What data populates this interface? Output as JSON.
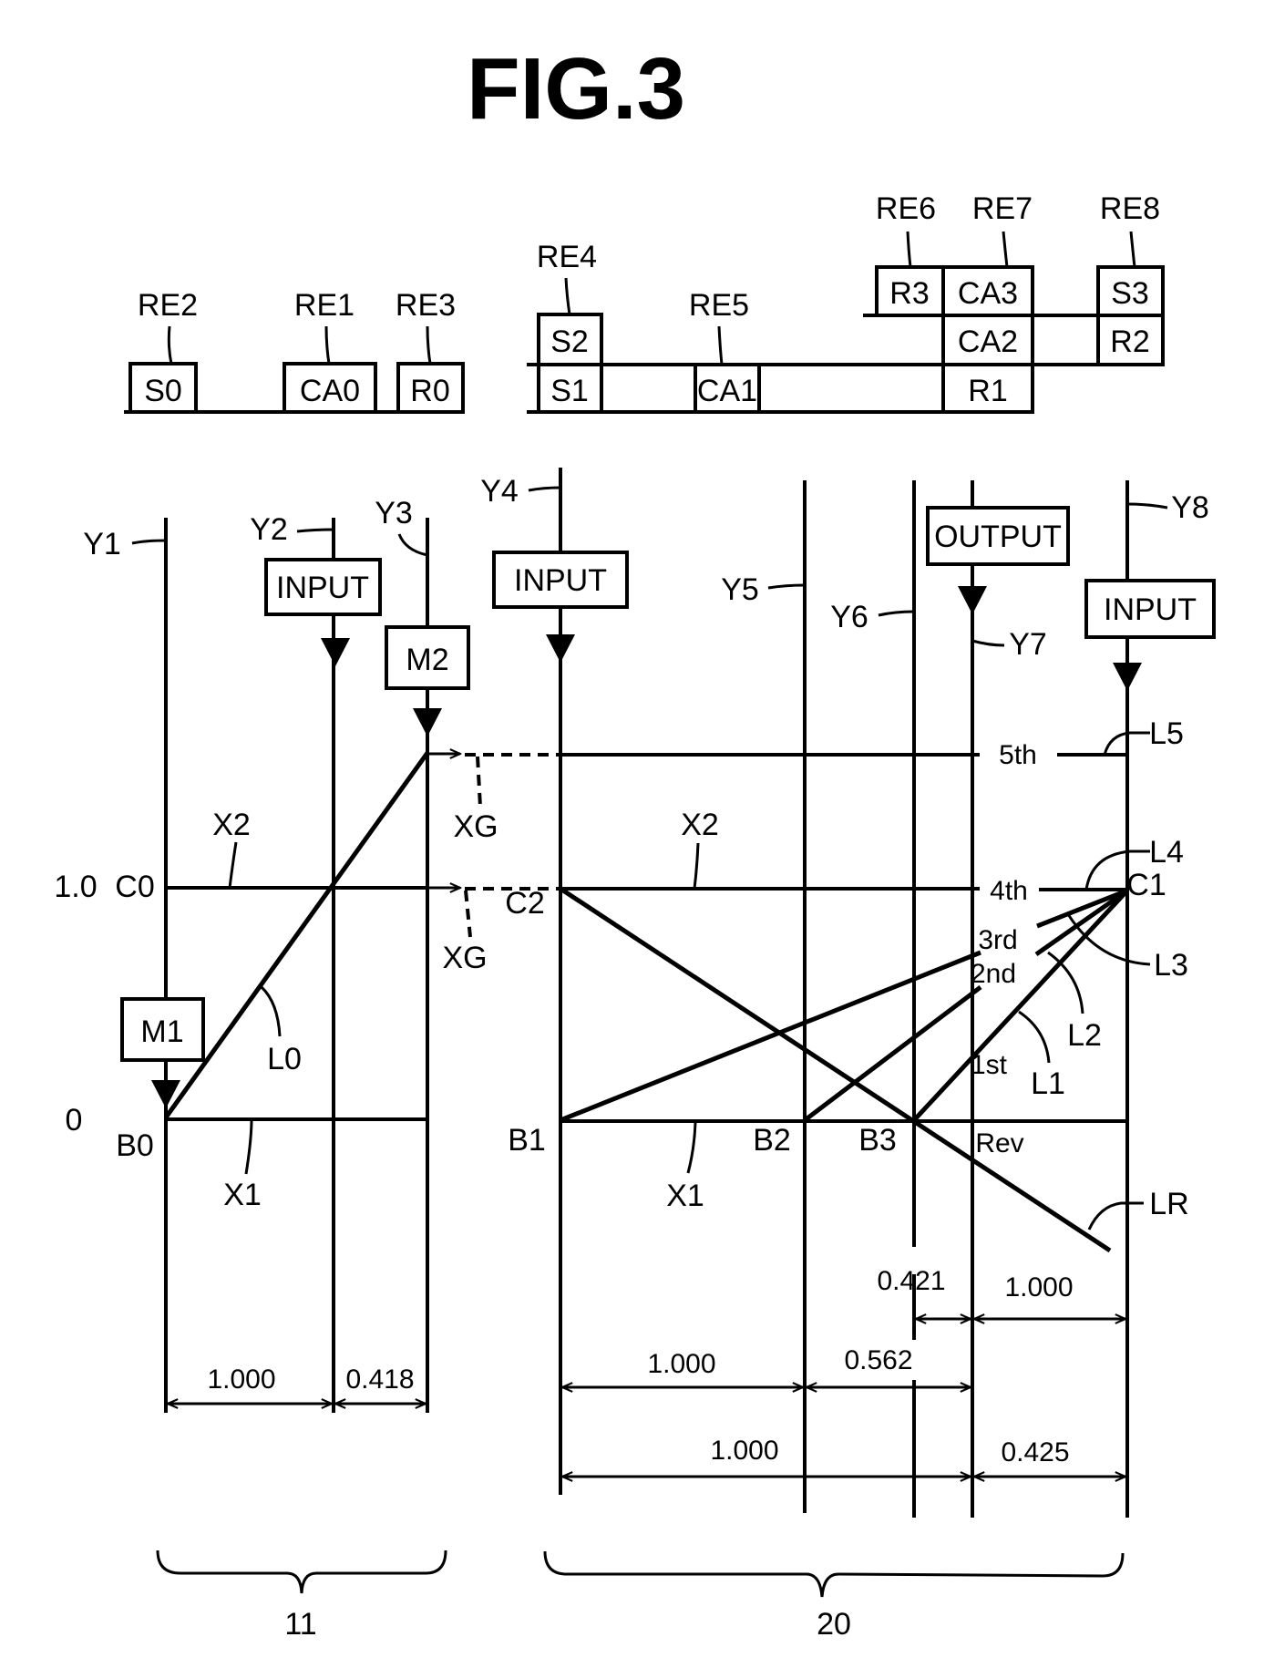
{
  "figure": {
    "title": "FIG.3"
  },
  "elements_top_left": {
    "labels": [
      "RE2",
      "RE1",
      "RE3"
    ],
    "boxes": [
      "S0",
      "CA0",
      "R0"
    ]
  },
  "elements_top_right": {
    "labels": [
      "RE4",
      "RE5",
      "RE6",
      "RE7",
      "RE8"
    ],
    "boxes": {
      "s2": "S2",
      "s1": "S1",
      "ca1": "CA1",
      "r3": "R3",
      "ca3": "CA3",
      "ca2": "CA2",
      "r1": "R1",
      "s3": "S3",
      "r2": "R2"
    }
  },
  "axes": {
    "y1": "Y1",
    "y2": "Y2",
    "y3": "Y3",
    "y4": "Y4",
    "y5": "Y5",
    "y6": "Y6",
    "y7": "Y7",
    "y8": "Y8"
  },
  "boxes": {
    "input_y2": "INPUT",
    "m2": "M2",
    "m1": "M1",
    "input_y4": "INPUT",
    "output_y7": "OUTPUT",
    "input_y8": "INPUT"
  },
  "levels": {
    "one": "1.0",
    "zero": "0"
  },
  "points": {
    "c0": "C0",
    "b0": "B0",
    "c2": "C2",
    "c1": "C1",
    "b1": "B1",
    "b2": "B2",
    "b3": "B3"
  },
  "lines": {
    "x2_left": "X2",
    "x1_left": "X1",
    "l0": "L0",
    "xg_upper": "XG",
    "xg_lower": "XG",
    "x2_right": "X2",
    "x1_right": "X1",
    "l1": "L1",
    "l2": "L2",
    "l3": "L3",
    "l4": "L4",
    "l5": "L5",
    "lr": "LR"
  },
  "gears": {
    "fifth": "5th",
    "fourth": "4th",
    "third": "3rd",
    "second": "2nd",
    "first": "1st",
    "rev": "Rev"
  },
  "dimensions": {
    "left_a": "1.000",
    "left_b": "0.418",
    "right_row1_a": "0.421",
    "right_row1_b": "1.000",
    "right_row2_a": "1.000",
    "right_row2_b": "0.562",
    "right_row3_a": "1.000",
    "right_row3_b": "0.425"
  },
  "groups": {
    "left": "11",
    "right": "20"
  }
}
